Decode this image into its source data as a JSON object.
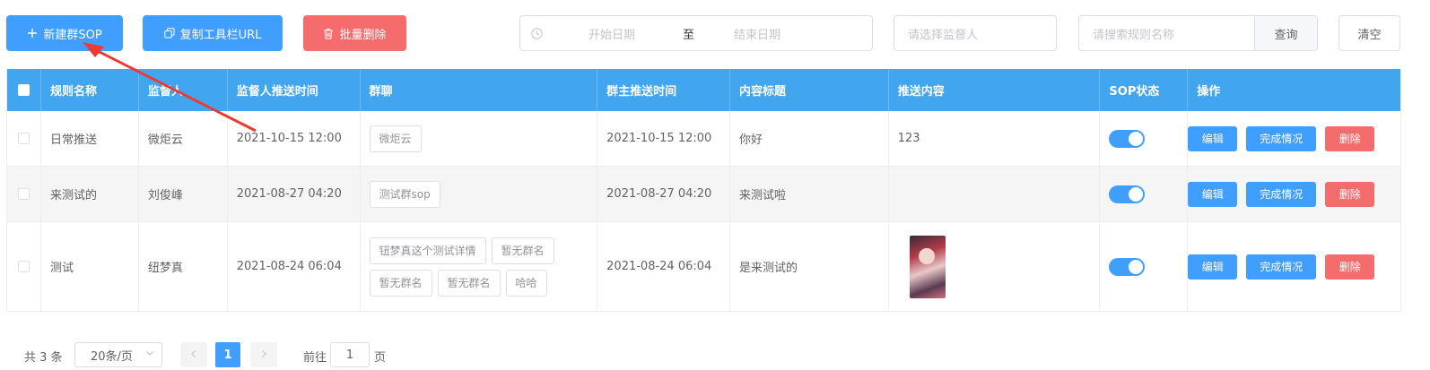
{
  "toolbar": {
    "new_sop": "新建群SOP",
    "copy_url": "复制工具栏URL",
    "batch_delete": "批量删除",
    "date_start_placeholder": "开始日期",
    "date_separator": "至",
    "date_end_placeholder": "结束日期",
    "supervisor_placeholder": "请选择监督人",
    "search_placeholder": "请搜索规则名称",
    "query": "查询",
    "clear": "清空"
  },
  "table": {
    "headers": [
      "规则名称",
      "监督人",
      "监督人推送时间",
      "群聊",
      "群主推送时间",
      "内容标题",
      "推送内容",
      "SOP状态",
      "操作"
    ],
    "rows": [
      {
        "name": "日常推送",
        "supervisor": "微炬云",
        "supervisor_time": "2021-10-15 12:00",
        "groups": [
          "微炬云"
        ],
        "owner_time": "2021-10-15 12:00",
        "title": "你好",
        "content": "123",
        "has_image": false,
        "status_on": true
      },
      {
        "name": "来测试的",
        "supervisor": "刘俊峰",
        "supervisor_time": "2021-08-27 04:20",
        "groups": [
          "测试群sop"
        ],
        "owner_time": "2021-08-27 04:20",
        "title": "来测试啦",
        "content": "",
        "has_image": false,
        "status_on": true
      },
      {
        "name": "测试",
        "supervisor": "纽梦真",
        "supervisor_time": "2021-08-24 06:04",
        "groups": [
          "钮梦真这个测试详情",
          "暂无群名",
          "暂无群名",
          "暂无群名",
          "哈哈"
        ],
        "owner_time": "2021-08-24 06:04",
        "title": "是来测试的",
        "content": "",
        "has_image": true,
        "status_on": true
      }
    ],
    "actions": {
      "edit": "编辑",
      "completion": "完成情况",
      "delete": "删除"
    }
  },
  "pagination": {
    "total": "共 3 条",
    "page_size": "20条/页",
    "current_page": "1",
    "goto_label": "前往",
    "goto_value": "1",
    "goto_unit": "页"
  },
  "colors": {
    "primary": "#409eff",
    "danger": "#f56c6c",
    "header": "#41a5ef",
    "annotation_arrow": "#ee3b32"
  },
  "icons": {
    "new_sop": "plus-icon",
    "copy_url": "copy-icon",
    "batch_delete": "trash-icon",
    "date": "clock-icon",
    "page_size": "chevron-down-icon",
    "prev": "chevron-left-icon",
    "next": "chevron-right-icon"
  }
}
